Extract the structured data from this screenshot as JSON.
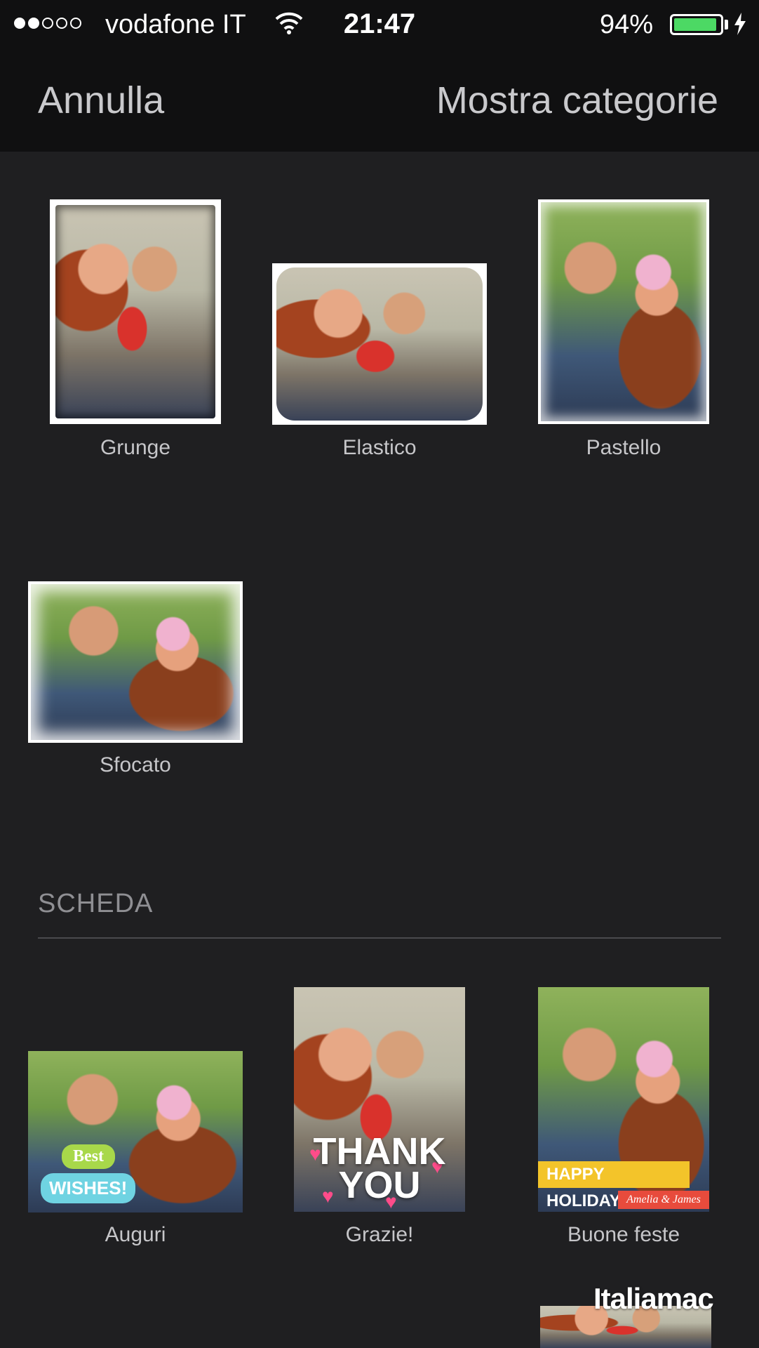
{
  "status_bar": {
    "carrier": "vodafone IT",
    "time": "21:47",
    "battery_percent": "94%",
    "battery_level": 0.94,
    "signal_bars": 2
  },
  "nav": {
    "cancel_label": "Annulla",
    "categories_label": "Mostra categorie"
  },
  "frames": [
    {
      "label": "Grunge"
    },
    {
      "label": "Elastico"
    },
    {
      "label": "Pastello"
    },
    {
      "label": "Sfocato"
    }
  ],
  "section": {
    "title": "SCHEDA"
  },
  "cards": [
    {
      "label": "Auguri",
      "overlay_top": "Best",
      "overlay_bottom": "WISHES!"
    },
    {
      "label": "Grazie!",
      "overlay_line1": "THANK",
      "overlay_line2": "YOU"
    },
    {
      "label": "Buone feste",
      "overlay_banner": "HAPPY HOLIDAYS",
      "overlay_names": "Amelia & James"
    }
  ],
  "watermark": "Italiamac"
}
